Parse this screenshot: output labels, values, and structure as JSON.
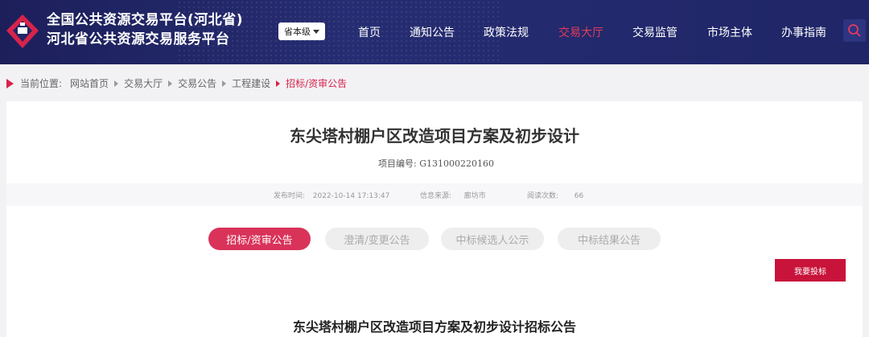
{
  "header": {
    "brand_line1": "全国公共资源交易平台(河北省)",
    "brand_line2": "河北省公共资源交易服务平台",
    "level_select": "省本级",
    "nav": [
      {
        "label": "首页",
        "active": false
      },
      {
        "label": "通知公告",
        "active": false
      },
      {
        "label": "政策法规",
        "active": false
      },
      {
        "label": "交易大厅",
        "active": true
      },
      {
        "label": "交易监管",
        "active": false
      },
      {
        "label": "市场主体",
        "active": false
      },
      {
        "label": "办事指南",
        "active": false
      }
    ]
  },
  "breadcrumb": {
    "prefix": "当前位置:",
    "items": [
      "网站首页",
      "交易大厅",
      "交易公告",
      "工程建设"
    ],
    "current": "招标/资审公告"
  },
  "detail": {
    "title": "东尖塔村棚户区改造项目方案及初步设计",
    "project_no_label": "项目编号:",
    "project_no": "G131000220160",
    "publish_label": "发布时间:",
    "publish_time": "2022-10-14 17:13:47",
    "source_label": "信息来源:",
    "source": "廊坊市",
    "views_label": "阅读次数:",
    "views": "66"
  },
  "tabs": [
    {
      "label": "招标/资审公告",
      "active": true
    },
    {
      "label": "澄清/变更公告",
      "active": false
    },
    {
      "label": "中标候选人公示",
      "active": false
    },
    {
      "label": "中标结果公告",
      "active": false
    }
  ],
  "bid_button": "我要投标",
  "notice_title": "东尖塔村棚户区改造项目方案及初步设计招标公告",
  "colors": {
    "header_bg": "#1f2566",
    "accent": "#d9335a",
    "nav_active": "#e33a5c"
  }
}
